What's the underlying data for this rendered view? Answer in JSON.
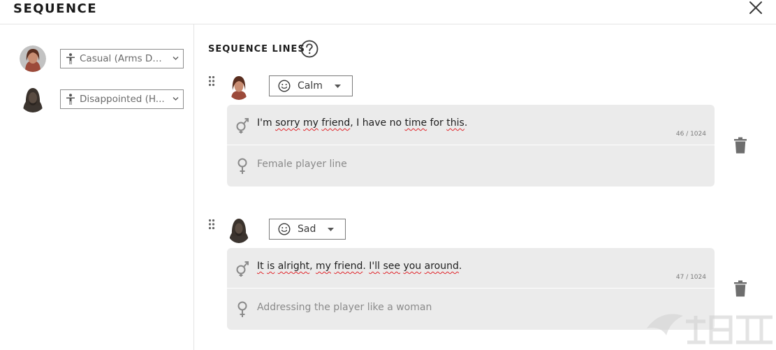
{
  "header": {
    "title": "SEQUENCE"
  },
  "characters": [
    {
      "name": "character-1",
      "pose": "Casual (Arms Do...",
      "avatar_colors": {
        "hair": "#5a2e1f",
        "skin": "#c98d72",
        "bg": "#bdbdbd"
      }
    },
    {
      "name": "character-2",
      "pose": "Disappointed (H...",
      "avatar_colors": {
        "hair": "#3c3530",
        "skin": "#5a4c42",
        "bg": "#ffffff"
      }
    }
  ],
  "sequence": {
    "title": "SEQUENCE LINES",
    "lines": [
      {
        "emotion": "Calm",
        "male_words": [
          {
            "t": "I'm ",
            "sq": false
          },
          {
            "t": "sorry",
            "sq": true
          },
          {
            "t": " ",
            "sq": false
          },
          {
            "t": "my",
            "sq": true
          },
          {
            "t": " ",
            "sq": false
          },
          {
            "t": "friend",
            "sq": true
          },
          {
            "t": ", I have no ",
            "sq": false
          },
          {
            "t": "time",
            "sq": true
          },
          {
            "t": " for ",
            "sq": false
          },
          {
            "t": "this",
            "sq": true
          },
          {
            "t": ".",
            "sq": false
          }
        ],
        "counter": "46 / 1024",
        "female_placeholder": "Female player line"
      },
      {
        "emotion": "Sad",
        "male_words": [
          {
            "t": "It",
            "sq": true
          },
          {
            "t": " ",
            "sq": false
          },
          {
            "t": "is",
            "sq": true
          },
          {
            "t": " ",
            "sq": false
          },
          {
            "t": "alright",
            "sq": true
          },
          {
            "t": ", ",
            "sq": false
          },
          {
            "t": "my",
            "sq": true
          },
          {
            "t": " ",
            "sq": false
          },
          {
            "t": "friend",
            "sq": true
          },
          {
            "t": ". ",
            "sq": false
          },
          {
            "t": "I'll",
            "sq": true
          },
          {
            "t": " ",
            "sq": false
          },
          {
            "t": "see",
            "sq": true
          },
          {
            "t": " ",
            "sq": false
          },
          {
            "t": "you",
            "sq": true
          },
          {
            "t": " ",
            "sq": false
          },
          {
            "t": "around",
            "sq": true
          },
          {
            "t": ".",
            "sq": false
          }
        ],
        "counter": "47 / 1024",
        "female_placeholder": "Addressing the player like a woman"
      }
    ]
  },
  "icons": {
    "close": "close-icon",
    "help": "help-icon",
    "pose": "person-pose-icon",
    "emotion": "smiley-icon",
    "male": "male-symbol-icon",
    "female": "female-symbol-icon",
    "trash": "trash-icon",
    "drag": "drag-handle-icon"
  },
  "colors": {
    "spellcheck": "#e0262b",
    "card_bg": "#ebebeb",
    "icon_gray": "#8a8a8a"
  }
}
